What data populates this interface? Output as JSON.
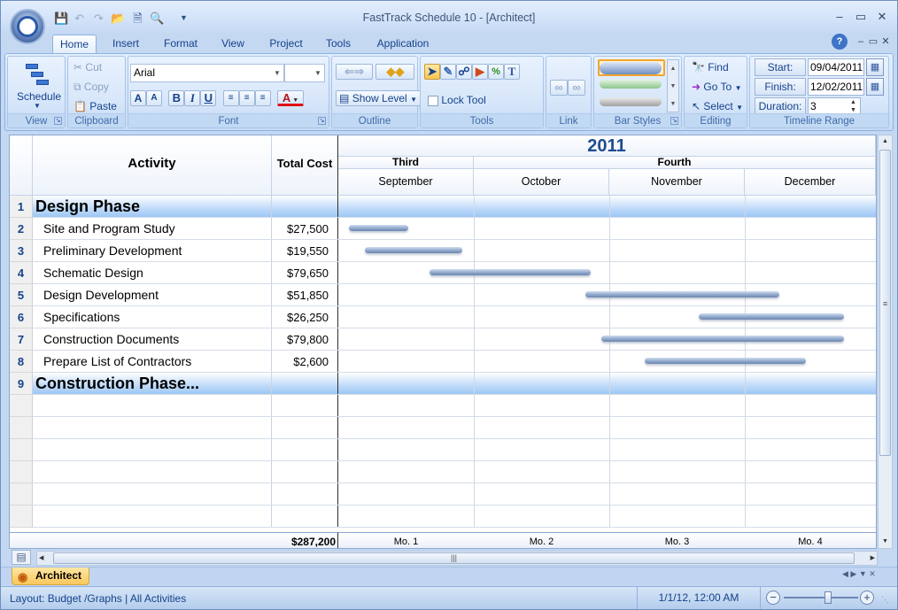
{
  "app": {
    "title": "FastTrack Schedule 10 - [Architect]"
  },
  "quick_access": {
    "items": [
      "save-icon",
      "undo-icon",
      "redo-icon",
      "open-icon",
      "new-icon",
      "print-preview-icon",
      "customize-icon"
    ]
  },
  "window_controls": {
    "minimize": "–",
    "restore": "▭",
    "close": "✕",
    "ribbon_min": "–",
    "ribbon_restore": "▭",
    "ribbon_close": "✕",
    "help": "?"
  },
  "tabs": [
    {
      "label": "Home"
    },
    {
      "label": "Insert"
    },
    {
      "label": "Format"
    },
    {
      "label": "View"
    },
    {
      "label": "Project"
    },
    {
      "label": "Tools"
    },
    {
      "label": "Application"
    }
  ],
  "ribbon": {
    "view": {
      "label": "View",
      "schedule_label": "Schedule"
    },
    "clipboard": {
      "label": "Clipboard",
      "cut": "Cut",
      "copy": "Copy",
      "paste": "Paste"
    },
    "font": {
      "label": "Font",
      "family": "Arial",
      "size": "",
      "grow": "A",
      "shrink": "A",
      "bold": "B",
      "italic": "I",
      "underline": "U",
      "color": "A"
    },
    "outline": {
      "label": "Outline",
      "show_level": "Show Level"
    },
    "tools": {
      "label": "Tools",
      "lock_tool": "Lock Tool",
      "lock_checked": false
    },
    "link": {
      "label": "Link"
    },
    "bar_styles": {
      "label": "Bar Styles",
      "colors": [
        "#6f8fc0",
        "#8cc68c",
        "#a0a0a0"
      ]
    },
    "editing": {
      "label": "Editing",
      "find": "Find",
      "goto": "Go To",
      "select": "Select"
    },
    "timeline": {
      "label": "Timeline Range",
      "start_label": "Start:",
      "start": "09/04/2011",
      "finish_label": "Finish:",
      "finish": "12/02/2011",
      "duration_label": "Duration:",
      "duration": "3"
    }
  },
  "grid": {
    "col_activity": "Activity",
    "col_cost": "Total Cost",
    "year": "2011",
    "quarters": [
      {
        "label": "Third"
      },
      {
        "label": "Fourth"
      }
    ],
    "months": [
      "September",
      "October",
      "November",
      "December"
    ],
    "rows": [
      {
        "num": "1",
        "activity": "Design Phase",
        "cost": "",
        "phase": true
      },
      {
        "num": "2",
        "activity": "Site and Program Study",
        "cost": "$27,500",
        "start": 0.02,
        "end": 0.13
      },
      {
        "num": "3",
        "activity": "Preliminary Development",
        "cost": "$19,550",
        "start": 0.05,
        "end": 0.23
      },
      {
        "num": "4",
        "activity": "Schematic Design",
        "cost": "$79,650",
        "start": 0.17,
        "end": 0.47
      },
      {
        "num": "5",
        "activity": "Design Development",
        "cost": "$51,850",
        "start": 0.46,
        "end": 0.82
      },
      {
        "num": "6",
        "activity": "Specifications",
        "cost": "$26,250",
        "start": 0.67,
        "end": 0.94
      },
      {
        "num": "7",
        "activity": "Construction Documents",
        "cost": "$79,800",
        "start": 0.49,
        "end": 0.94
      },
      {
        "num": "8",
        "activity": "Prepare List of Contractors",
        "cost": "$2,600",
        "start": 0.57,
        "end": 0.87
      },
      {
        "num": "9",
        "activity": "Construction Phase...",
        "cost": "",
        "phase": true
      }
    ],
    "total": "$287,200",
    "footer_periods": [
      "Mo. 1",
      "Mo. 2",
      "Mo. 3",
      "Mo. 4"
    ]
  },
  "layout_tab": {
    "label": "Architect"
  },
  "status": {
    "layout": "Layout: Budget /Graphs | All Activities",
    "datetime": "1/1/12, 12:00 AM",
    "zoom_position": 0.6
  }
}
